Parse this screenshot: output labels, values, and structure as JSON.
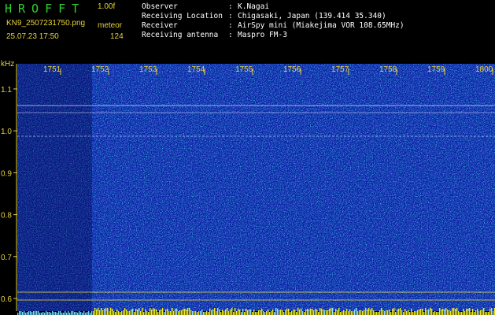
{
  "header": {
    "app_title": "HROFFT",
    "version": "1.00f",
    "filename": "KN9_2507231750.png",
    "meteor_label": "meteor",
    "datetime": "25.07.23 17:50",
    "count": "124"
  },
  "info": [
    {
      "key": "Observer",
      "sep": ":",
      "value": "K.Nagai"
    },
    {
      "key": "Receiving Location",
      "sep": ":",
      "value": "Chigasaki, Japan (139.414 35.340)"
    },
    {
      "key": "Receiver",
      "sep": ":",
      "value": "AirSpy mini (Miakejima VOR 108.65MHz)"
    },
    {
      "key": "Receiving antenna",
      "sep": ":",
      "value": "Maspro FM-3"
    }
  ],
  "spectrogram": {
    "unit_label": "kHz",
    "time_ticks": [
      "1751",
      "1752",
      "1753",
      "1754",
      "1755",
      "1756",
      "1757",
      "1758",
      "1759",
      "1800"
    ],
    "freq_ticks": [
      "1.1",
      "1.0",
      "0.9",
      "0.8",
      "0.7",
      "0.6"
    ],
    "freq_range": [
      0.57,
      1.16
    ],
    "colors": {
      "background": "#0a1aa0",
      "label": "#e6d23a",
      "grid": "#e6d23a"
    }
  }
}
